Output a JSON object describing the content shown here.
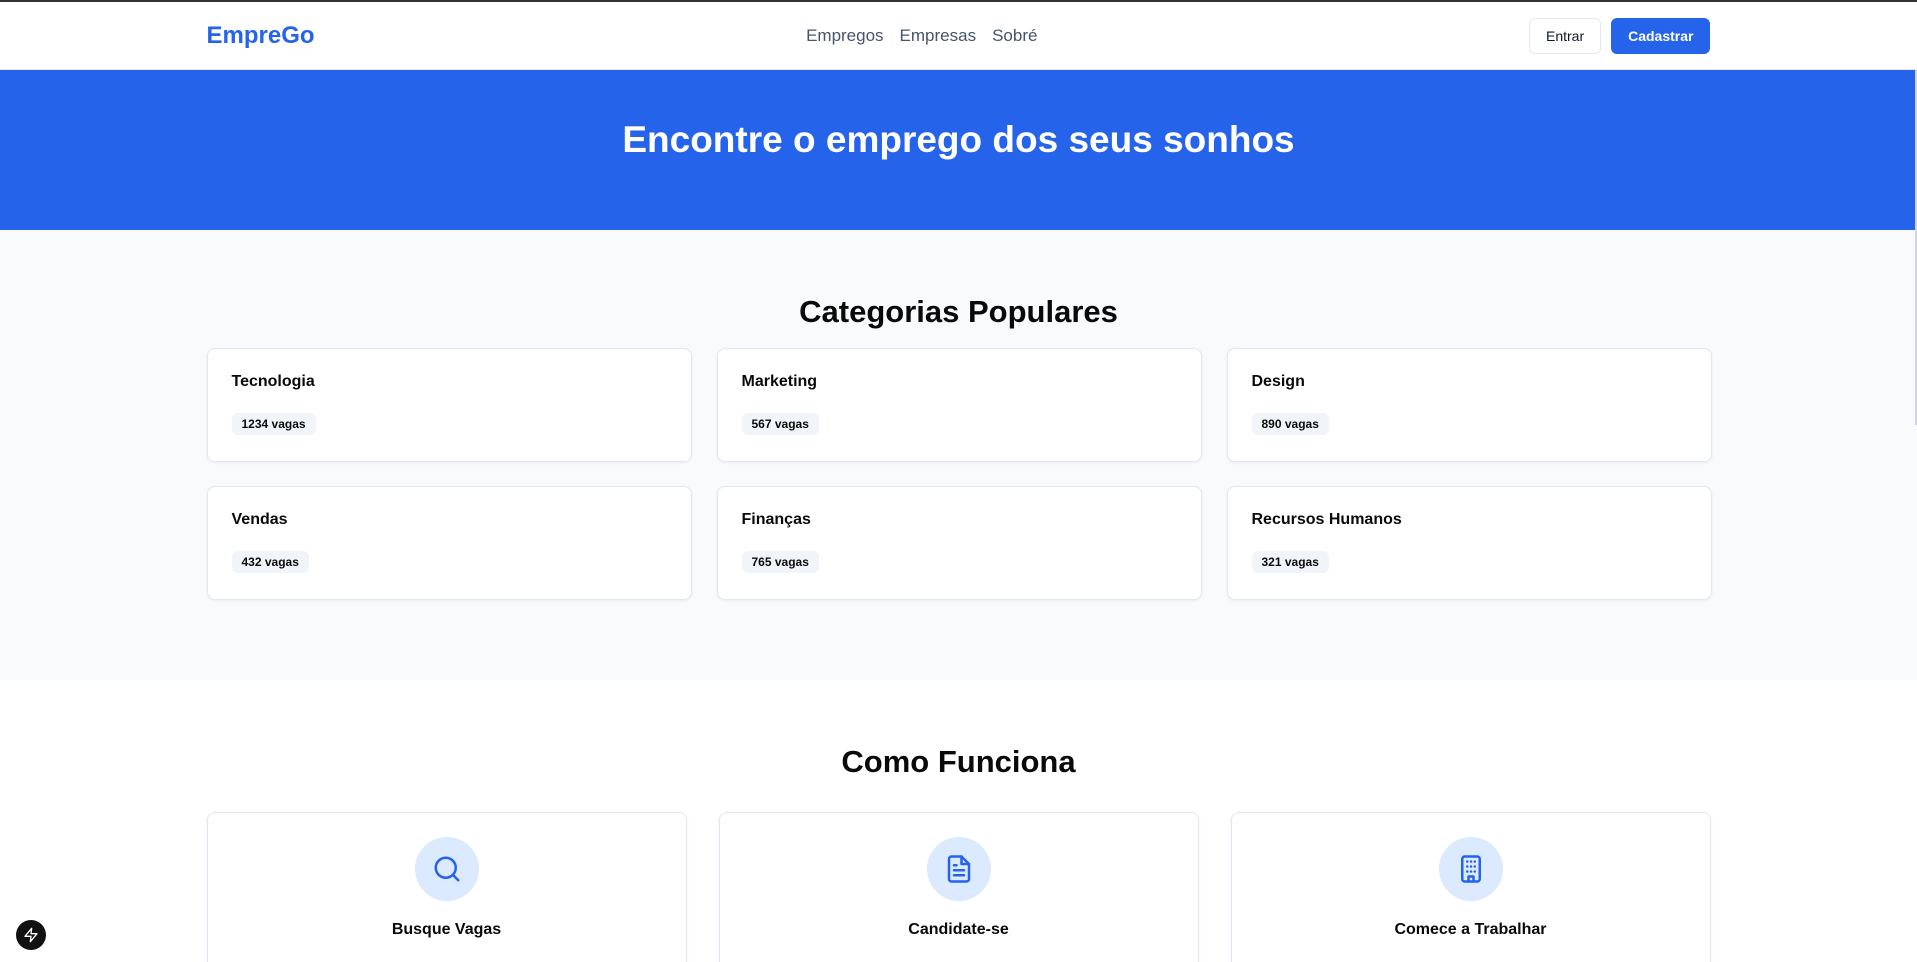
{
  "header": {
    "brand": "EmpreGo",
    "nav": [
      "Empregos",
      "Empresas",
      "Sobré"
    ],
    "login_label": "Entrar",
    "signup_label": "Cadastrar"
  },
  "hero": {
    "title": "Encontre o emprego dos seus sonhos"
  },
  "categories": {
    "title": "Categorias Populares",
    "items": [
      {
        "name": "Tecnologia",
        "count": "1234 vagas"
      },
      {
        "name": "Marketing",
        "count": "567 vagas"
      },
      {
        "name": "Design",
        "count": "890 vagas"
      },
      {
        "name": "Vendas",
        "count": "432 vagas"
      },
      {
        "name": "Finanças",
        "count": "765 vagas"
      },
      {
        "name": "Recursos Humanos",
        "count": "321 vagas"
      }
    ]
  },
  "how": {
    "title": "Como Funciona",
    "steps": [
      {
        "title": "Busque Vagas",
        "icon": "search-icon"
      },
      {
        "title": "Candidate-se",
        "icon": "document-icon"
      },
      {
        "title": "Comece a Trabalhar",
        "icon": "building-icon"
      }
    ]
  },
  "colors": {
    "primary": "#2563eb",
    "icon_bg": "#dbeafe",
    "section_bg": "#f8fafc"
  }
}
